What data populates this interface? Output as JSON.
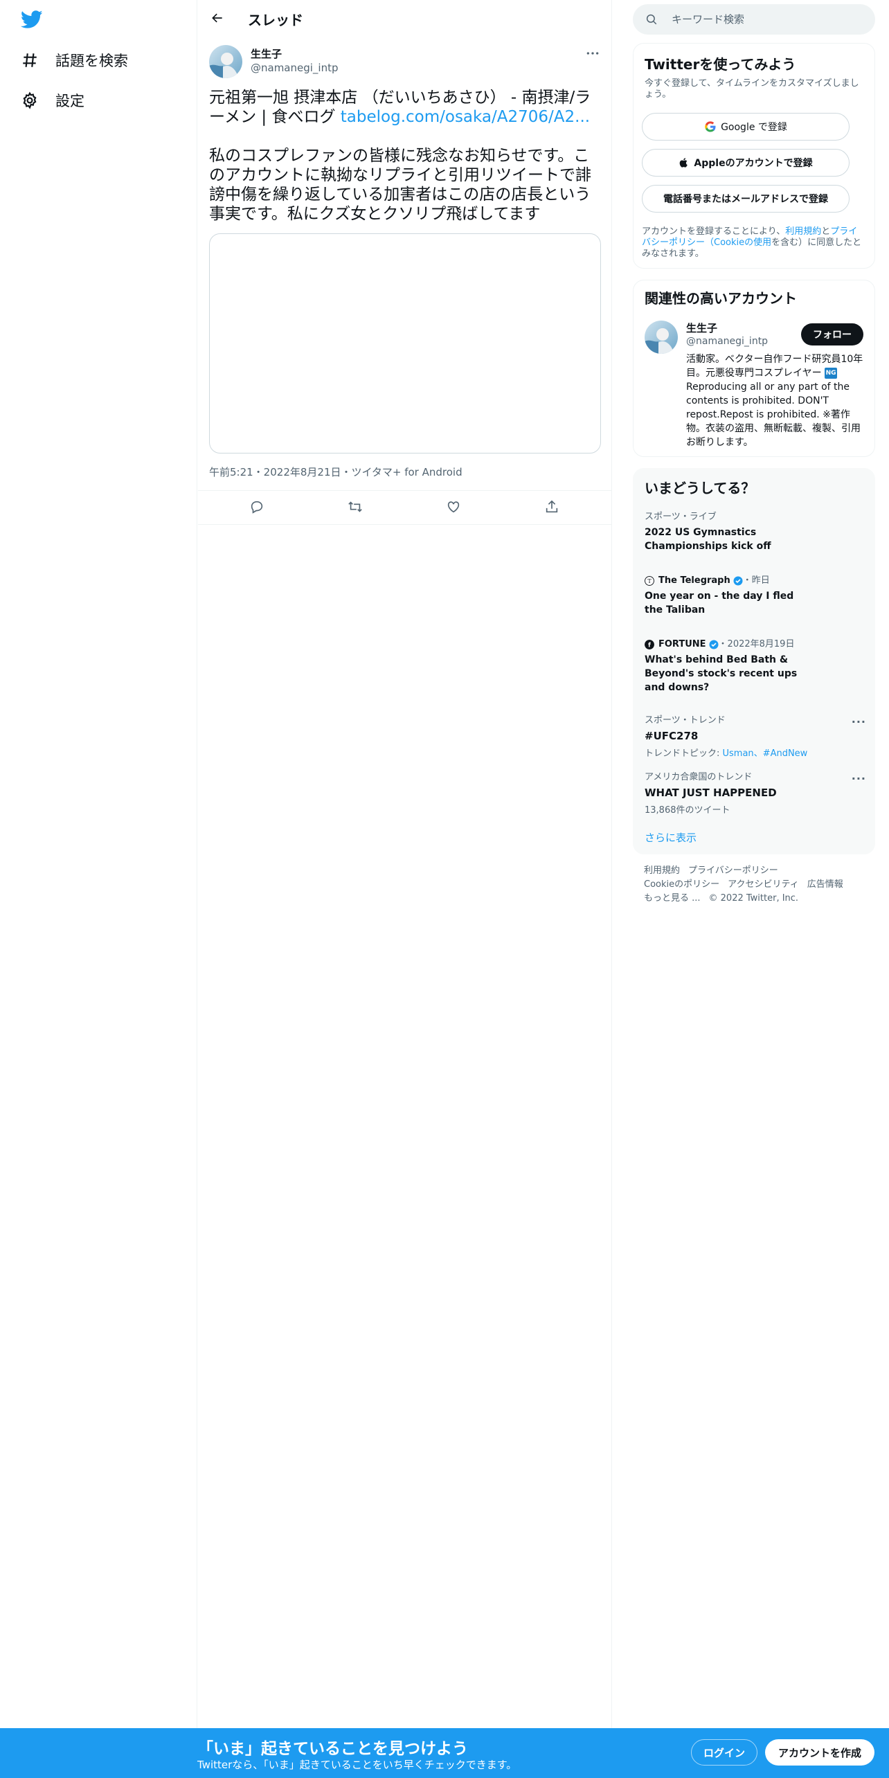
{
  "colors": {
    "brand": "#1d9bf0",
    "text": "#0f1419",
    "muted": "#536471",
    "border": "#eff3f4"
  },
  "nav": {
    "logo_icon": "twitter-bird-icon",
    "items": [
      {
        "label": "話題を検索",
        "icon": "hashtag-icon"
      },
      {
        "label": "設定",
        "icon": "gear-icon"
      }
    ]
  },
  "header": {
    "title": "スレッド",
    "back_icon": "arrow-left-icon"
  },
  "tweet": {
    "author_name": "生生子",
    "author_handle": "@namanegi_intp",
    "text_before_link": "元祖第一旭 摂津本店 （だいいちあさひ） - 南摂津/ラーメン | 食べログ ",
    "link_text": "tabelog.com/osaka/A2706/A2...",
    "text_after_link": "\n\n私のコスプレファンの皆様に残念なお知らせです。このアカウントに執拗なリプライと引用リツイートで誹謗中傷を繰り返している加害者はこの店の店長という事実です。私にクズ女とクソリプ飛ばしてます",
    "meta": "午前5:21・2022年8月21日・ツイタマ+ for Android",
    "actions": [
      "reply-icon",
      "retweet-icon",
      "like-icon",
      "share-icon"
    ]
  },
  "search": {
    "placeholder": "キーワード検索"
  },
  "signup": {
    "title": "Twitterを使ってみよう",
    "subtitle": "今すぐ登録して、タイムラインをカスタマイズしましょう。",
    "google_label": "Google で登録",
    "apple_label": "Appleのアカウントで登録",
    "phone_label": "電話番号またはメールアドレスで登録",
    "legal_before": "アカウントを登録することにより、",
    "legal_terms": "利用規約",
    "legal_and": "と",
    "legal_privacy": "プライバシーポリシー（Cookieの使用",
    "legal_after": "を含む）に同意したとみなされます。"
  },
  "related": {
    "title": "関連性の高いアカウント",
    "name": "生生子",
    "handle": "@namanegi_intp",
    "follow_label": "フォロー",
    "bio_before_badge": "活動家。ベクター自作フード研究員10年目。元悪役専門コスプレイヤー ",
    "badge": "NG",
    "bio_after_badge": "Reproducing all or any part of the contents is prohibited. DON'T repost.Repost is prohibited. ※著作物。衣装の盗用、無断転載、複製、引用お断りします。"
  },
  "trends": {
    "title": "いまどうしてる？",
    "items": [
      {
        "context": "スポーツ・ライブ",
        "title": "2022 US Gymnastics Championships kick off"
      },
      {
        "source": "The Telegraph",
        "time": "・昨日",
        "title": "One year on - the day I fled the Taliban"
      },
      {
        "source": "FORTUNE",
        "time": "・2022年8月19日",
        "title": "What's behind Bed Bath & Beyond's stock's recent ups and downs?"
      },
      {
        "context": "スポーツ・トレンド",
        "title": "#UFC278",
        "sub_prefix": "トレンドトピック: ",
        "sub_links": "Usman、#AndNew"
      },
      {
        "context": "アメリカ合衆国のトレンド",
        "title": "WHAT JUST HAPPENED",
        "sub": "13,868件のツイート"
      }
    ],
    "show_more": "さらに表示"
  },
  "footer": {
    "links": [
      "利用規約",
      "プライバシーポリシー",
      "Cookieのポリシー",
      "アクセシビリティ",
      "広告情報",
      "もっと見る ...",
      "© 2022 Twitter, Inc."
    ]
  },
  "banner": {
    "title": "「いま」起きていることを見つけよう",
    "subtitle": "Twitterなら、「いま」起きていることをいち早くチェックできます。",
    "login_label": "ログイン",
    "signup_label": "アカウントを作成"
  }
}
